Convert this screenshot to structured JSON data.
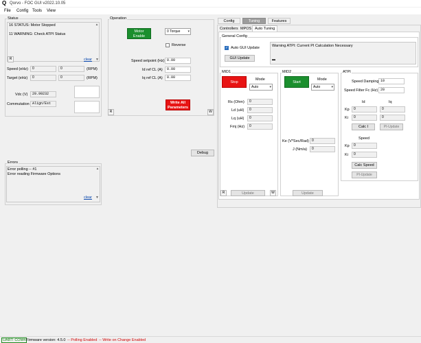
{
  "window": {
    "logo": "Q",
    "title": "Qorvo - FOC GUI v2022.10.05"
  },
  "menu": [
    "File",
    "Config",
    "Tools",
    "View"
  ],
  "status": {
    "label": "Status",
    "messages": [
      "16 STATUS: Motor Stopped",
      "11 WARNING: Check ATPI Status"
    ],
    "reset": "R",
    "clear": "clear",
    "speed_label": "Speed (eHz)",
    "speed_val1": "0",
    "speed_val2": "0",
    "speed_unit": "(RPM)",
    "target_label": "Target (eHz)",
    "target_val1": "0",
    "target_val2": "0",
    "target_unit": "(RPM)",
    "vdc_label": "Vdc (V)",
    "vdc_val": "29.99232",
    "comm_label": "Commutation",
    "comm_val": "Align/Est"
  },
  "operation": {
    "label": "Operation",
    "motor_enable": "Motor\nEnable",
    "torque_select": "0 Torque",
    "reverse": "Reverse",
    "speed_sp_label": "Speed setpoint (Hz)",
    "speed_sp": "0.00",
    "id_ref_label": "Id ref CL (A)",
    "id_ref": "0.00",
    "iq_ref_label": "Iq ref CL (A)",
    "iq_ref": "0.00",
    "write_all": "Write All\nParameters",
    "r_btn": "R",
    "w_btn": "W"
  },
  "debug": "Debug",
  "errors": {
    "label": "Errors",
    "messages": [
      "Error polling -- #1",
      "Error reading Firmware Options"
    ],
    "clear": "clear"
  },
  "right": {
    "tabs": [
      "Config",
      "Tuning",
      "Features"
    ],
    "active_tab": "Tuning",
    "subtabs": [
      "Controllers",
      "MPOS",
      "Auto Tuning"
    ],
    "active_subtab": "Auto Tuning",
    "general": {
      "label": "General Config",
      "auto_gui": "Auto GUI Update",
      "gui_update": "GUI Update",
      "warning": "Warning ATPI: Current PI Calculation Necessary"
    },
    "mid1": {
      "label": "MID1",
      "stop": "Stop",
      "mode_label": "Mode",
      "mode": "Auto",
      "rs_label": "Rs (Ohm)",
      "rs": "0",
      "ld_label": "Ld (uH)",
      "ld": "0",
      "lq_label": "Lq (uH)",
      "lq": "0",
      "fm_label": "Fmj (Hz)",
      "fm": "0",
      "r_btn": "R",
      "update": "Update",
      "w_btn": "W"
    },
    "mid2": {
      "label": "MID2",
      "start": "Start",
      "mode_label": "Mode",
      "mode": "Auto",
      "ke_label": "Ke (V*Sec/Rad)",
      "ke": "0",
      "j_label": "J (Nm/a)",
      "j": "0",
      "update": "Update"
    },
    "atpi": {
      "label": "ATPI",
      "damp_label": "Speed Damping",
      "damp": "10",
      "filt_label": "Speed Filter Fc (Hz)",
      "filt": "20",
      "id_head": "Id",
      "iq_head": "Iq",
      "kp_label": "Kp",
      "ki_label": "Ki",
      "id_kp": "0",
      "id_ki": "0",
      "iq_kp": "0",
      "iq_ki": "0",
      "calc_i": "Calc I",
      "pi_update": "PI-Update",
      "speed_head": "Speed",
      "sp_kp": "0",
      "sp_ki": "0",
      "calc_speed": "Calc Speed",
      "pi_update2": "PI-Update"
    }
  },
  "statusbar": {
    "uart": "UART: COM4",
    "firmware": "Firmware version:  4.5.0",
    "polling": "-- Polling Enabled",
    "write": "-- Write on Change Enabled"
  },
  "colors": {
    "green_btn": "#1b8f2e",
    "red_btn": "#e81414",
    "uart": "#1a8a1a",
    "status_red": "#d00000"
  }
}
